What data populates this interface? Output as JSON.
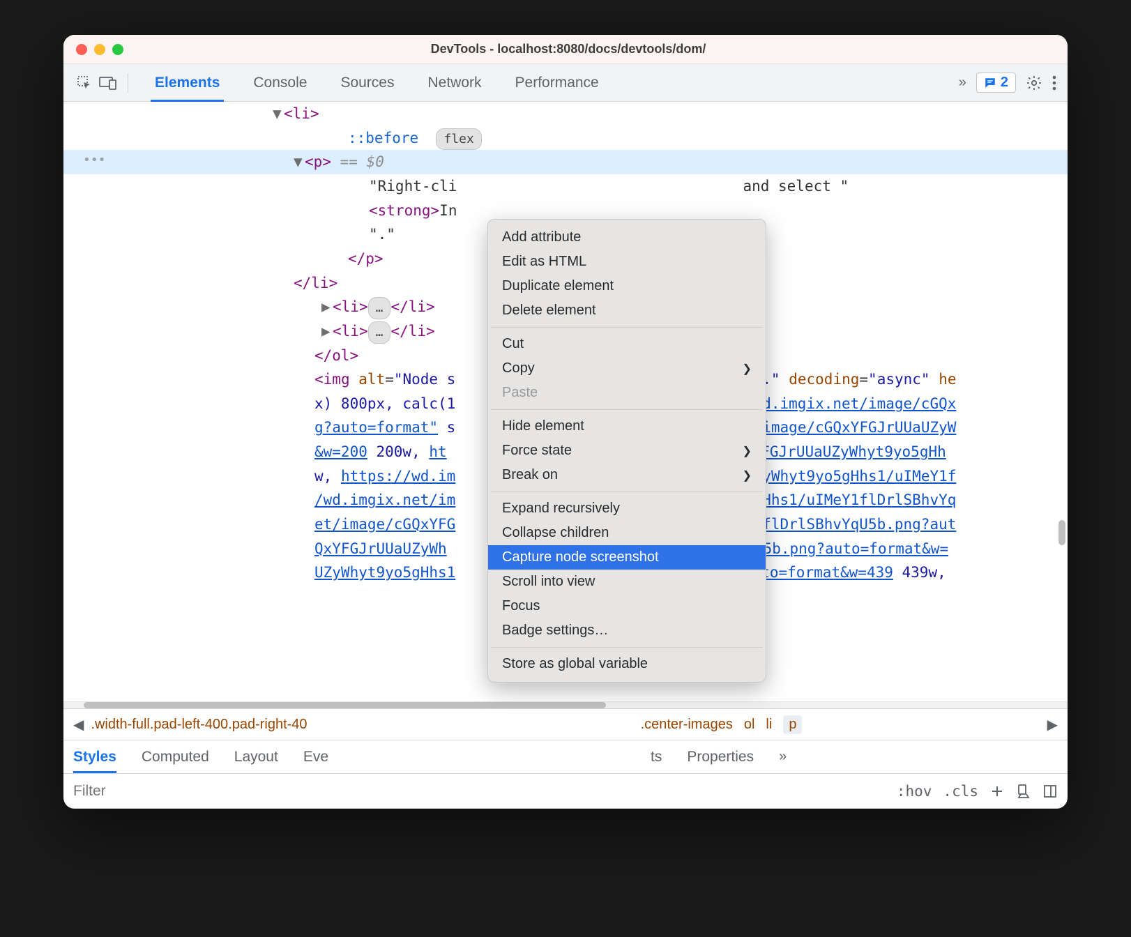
{
  "window": {
    "title": "DevTools - localhost:8080/docs/devtools/dom/"
  },
  "toolbar": {
    "tabs": [
      "Elements",
      "Console",
      "Sources",
      "Network",
      "Performance"
    ],
    "active_tab_index": 0,
    "overflow_glyph": "»",
    "issues_count": "2"
  },
  "dom": {
    "selection_gutter": "•••",
    "flex_badge": "flex",
    "pseudo": "::before",
    "eq_ghost": "== $0",
    "text_left": "\"Right-cli",
    "text_right": "and select \"",
    "strong_text": "In",
    "dot_text": "\".\"",
    "close_p": "</p>",
    "close_li": "</li>",
    "collapsed_badge": "…",
    "close_ol": "</ol>",
    "img_alt_start": "\"Node s",
    "img_alt_end": "ads.\"",
    "decoding_val": "\"async\"",
    "he_tail": "he",
    "row2a": "x) 800px, calc(1",
    "row2b": "//wd.imgix.net/image/cGQx",
    "row3a": "g?auto=format\"",
    "row3b": " s",
    "row3c": "et/image/cGQxYFGJrUUaUZyW",
    "row4a": "&w=200",
    "row4b": " 200w, ",
    "row4c": "ht",
    "row4d": "GQxYFGJrUUaUZyWhyt9yo5gHh",
    "row5a": "w, ",
    "row5b": "https://wd.im",
    "row5c": "aUZyWhyt9yo5gHhs1/uIMeY1f",
    "row6a": "/wd.imgix.net/im",
    "row6b": "p5gHhs1/uIMeY1flDrlSBhvYq",
    "row7a": "et/image/cGQxYFG",
    "row7b": "eY1flDrlSBhvYqU5b.png?aut",
    "row8a": "QxYFGJrUUaUZyWh",
    "row8b": "YqU5b.png?auto=format&w=",
    "row9a": "UZyWhyt9yo5gHhs1",
    "row9b": "?auto=format&w=439",
    "row9c": " 439w,"
  },
  "breadcrumbs": {
    "left": ".width-full.pad-left-400.pad-right-40",
    "mid": ".center-images",
    "items": [
      "ol",
      "li",
      "p"
    ]
  },
  "style_tabs": {
    "items": [
      "Styles",
      "Computed",
      "Layout",
      "Eve",
      "ts",
      "Properties"
    ],
    "overflow": "»",
    "active": 0
  },
  "filter": {
    "placeholder": "Filter",
    "hov": ":hov",
    "cls": ".cls"
  },
  "menu": {
    "items": [
      {
        "label": "Add attribute"
      },
      {
        "label": "Edit as HTML"
      },
      {
        "label": "Duplicate element"
      },
      {
        "label": "Delete element"
      },
      {
        "sep": true
      },
      {
        "label": "Cut"
      },
      {
        "label": "Copy",
        "sub": true
      },
      {
        "label": "Paste",
        "disabled": true
      },
      {
        "sep": true
      },
      {
        "label": "Hide element"
      },
      {
        "label": "Force state",
        "sub": true
      },
      {
        "label": "Break on",
        "sub": true
      },
      {
        "sep": true
      },
      {
        "label": "Expand recursively"
      },
      {
        "label": "Collapse children"
      },
      {
        "label": "Capture node screenshot",
        "highlight": true
      },
      {
        "label": "Scroll into view"
      },
      {
        "label": "Focus"
      },
      {
        "label": "Badge settings…"
      },
      {
        "sep": true
      },
      {
        "label": "Store as global variable"
      }
    ]
  }
}
